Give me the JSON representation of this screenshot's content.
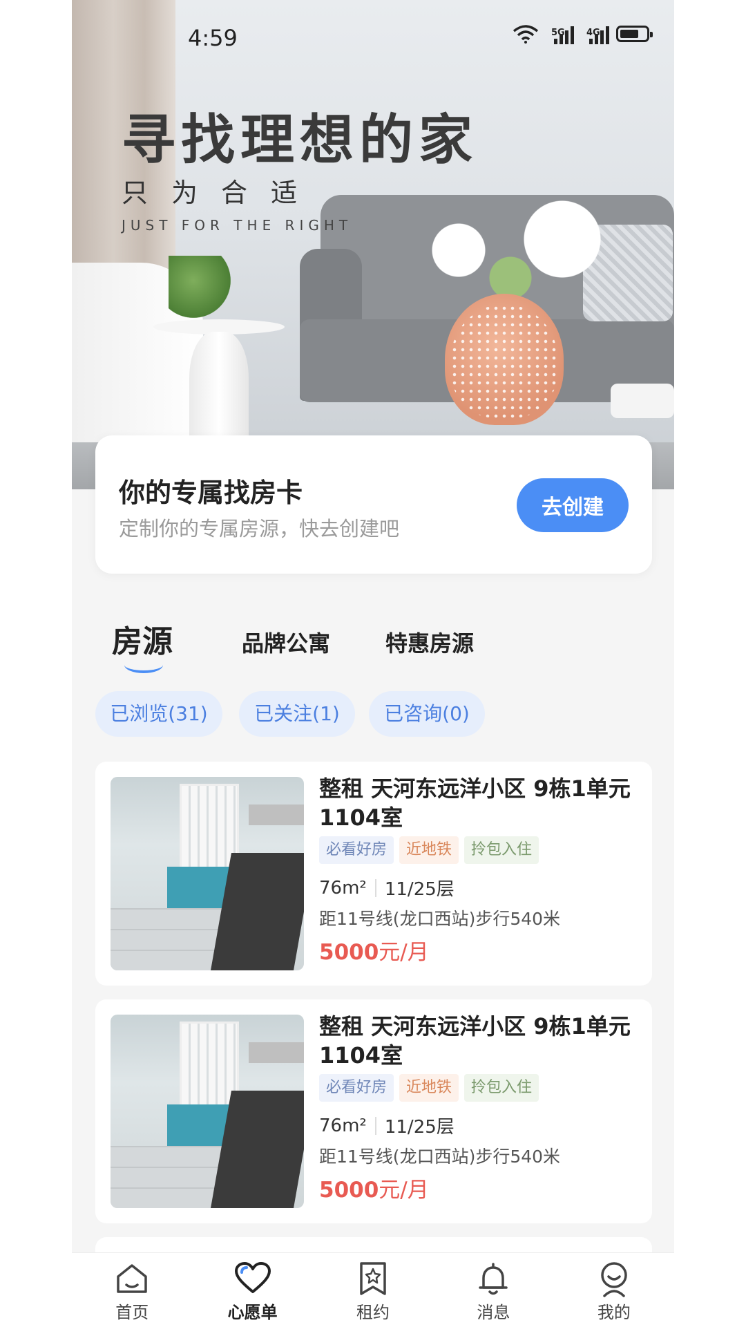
{
  "status_bar": {
    "time": "4:59",
    "sig1": "5G",
    "sig2": "4G"
  },
  "hero": {
    "title": "寻找理想的家",
    "subtitle": "只为合适",
    "english": "JUST FOR THE RIGHT"
  },
  "find_card": {
    "title": "你的专属找房卡",
    "description": "定制你的专属房源，快去创建吧",
    "button": "去创建",
    "button_color": "#4b8ef5"
  },
  "tabs": [
    {
      "label": "房源",
      "active": true
    },
    {
      "label": "品牌公寓",
      "active": false
    },
    {
      "label": "特惠房源",
      "active": false
    }
  ],
  "filters": [
    {
      "label": "已浏览(31)"
    },
    {
      "label": "已关注(1)"
    },
    {
      "label": "已咨询(0)"
    }
  ],
  "listings": [
    {
      "title": "整租 天河东远洋小区 9栋1单元1104室",
      "tags": [
        "必看好房",
        "近地铁",
        "拎包入住"
      ],
      "area": "76m²",
      "floor": "11/25层",
      "metro": "距11号线(龙口西站)步行540米",
      "price": "5000",
      "price_unit": "元/月"
    },
    {
      "title": "整租 天河东远洋小区 9栋1单元1104室",
      "tags": [
        "必看好房",
        "近地铁",
        "拎包入住"
      ],
      "area": "76m²",
      "floor": "11/25层",
      "metro": "距11号线(龙口西站)步行540米",
      "price": "5000",
      "price_unit": "元/月"
    }
  ],
  "bottom_nav": [
    {
      "label": "首页",
      "icon": "home-icon",
      "active": false
    },
    {
      "label": "心愿单",
      "icon": "heart-icon",
      "active": true
    },
    {
      "label": "租约",
      "icon": "bookmark-star-icon",
      "active": false
    },
    {
      "label": "消息",
      "icon": "bell-icon",
      "active": false
    },
    {
      "label": "我的",
      "icon": "profile-icon",
      "active": false
    }
  ],
  "colors": {
    "accent": "#4b8ef5",
    "price": "#e85a52",
    "chip_bg": "#e6eefc"
  }
}
